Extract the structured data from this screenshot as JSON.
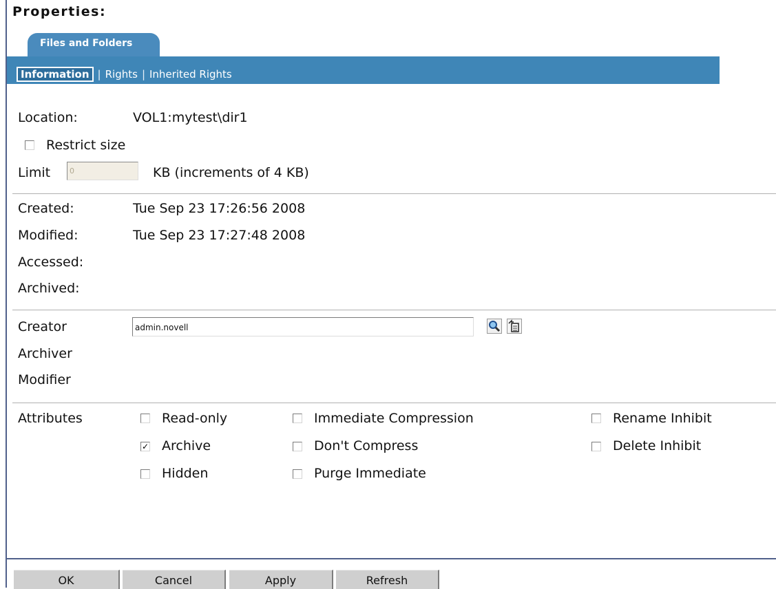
{
  "page_title": "Properties:",
  "tab": {
    "label": "Files and Folders"
  },
  "subtabs": [
    {
      "label": "Information",
      "active": true
    },
    {
      "label": "Rights",
      "active": false
    },
    {
      "label": "Inherited Rights",
      "active": false
    }
  ],
  "separator": "|",
  "location": {
    "label": "Location:",
    "value": "VOL1:mytest\\dir1"
  },
  "restrict_size": {
    "label": "Restrict size",
    "checked": false
  },
  "limit": {
    "label": "Limit",
    "value": "0",
    "units": "KB (increments of 4 KB)"
  },
  "dates": {
    "created_label": "Created:",
    "created_value": "Tue Sep 23 17:26:56 2008",
    "modified_label": "Modified:",
    "modified_value": "Tue Sep 23 17:27:48 2008",
    "accessed_label": "Accessed:",
    "archived_label": "Archived:"
  },
  "owners": {
    "creator_label": "Creator",
    "creator_value": "admin.novell",
    "archiver_label": "Archiver",
    "modifier_label": "Modifier",
    "browse_icon": "magnifier-icon",
    "history_icon": "object-history-icon"
  },
  "attributes": {
    "label": "Attributes",
    "read_only": {
      "label": "Read-only",
      "checked": false
    },
    "archive": {
      "label": "Archive",
      "checked": true
    },
    "hidden": {
      "label": "Hidden",
      "checked": false
    },
    "immediate_compression": {
      "label": "Immediate Compression",
      "checked": false
    },
    "dont_compress": {
      "label": "Don't Compress",
      "checked": false
    },
    "purge_immediate": {
      "label": "Purge Immediate",
      "checked": false
    },
    "rename_inhibit": {
      "label": "Rename Inhibit",
      "checked": false
    },
    "delete_inhibit": {
      "label": "Delete Inhibit",
      "checked": false
    }
  },
  "buttons": {
    "ok": "OK",
    "cancel": "Cancel",
    "apply": "Apply",
    "refresh": "Refresh"
  },
  "colors": {
    "tab_blue": "#3f86b7",
    "tab_active": "#4a8bbd",
    "checkmark": "✓"
  }
}
